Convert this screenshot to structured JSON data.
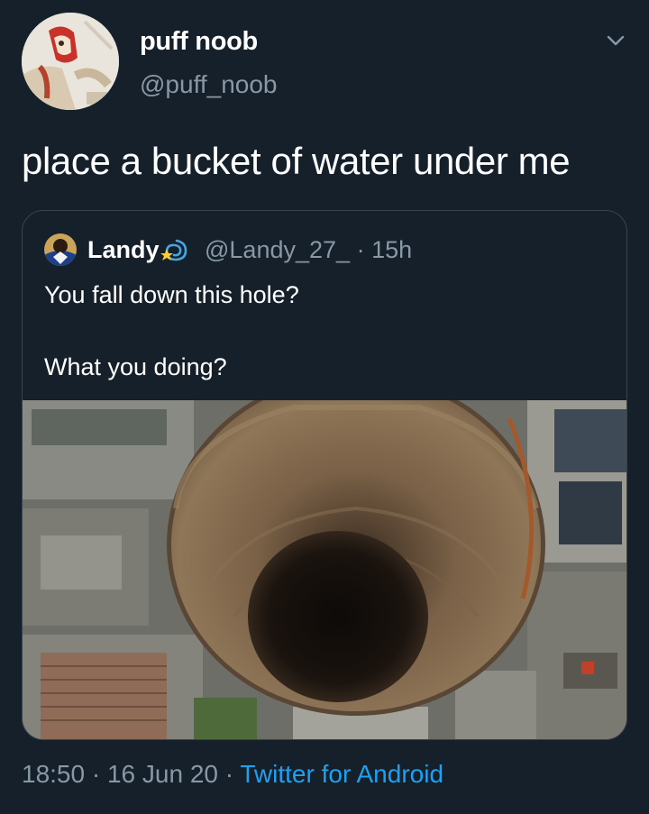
{
  "tweet": {
    "display_name": "puff noob",
    "handle": "@puff_noob",
    "text": "place a bucket of water under me",
    "time": "18:50",
    "date": "16 Jun 20",
    "separator": "·",
    "source": "Twitter for Android",
    "menu_icon": "chevron-down-icon"
  },
  "quoted_tweet": {
    "display_name": "Landy",
    "name_emojis": "dizzy-sparkle-emoji",
    "handle": "@Landy_27_",
    "separator": "·",
    "age": "15h",
    "text_line1": "You fall down this hole?",
    "text_line2": "What you doing?",
    "media": "photo-sinkhole-aerial"
  },
  "colors": {
    "background": "#15202b",
    "primary_text": "#ffffff",
    "secondary_text": "#8899a6",
    "link": "#1da1f2",
    "border": "#38444d"
  }
}
